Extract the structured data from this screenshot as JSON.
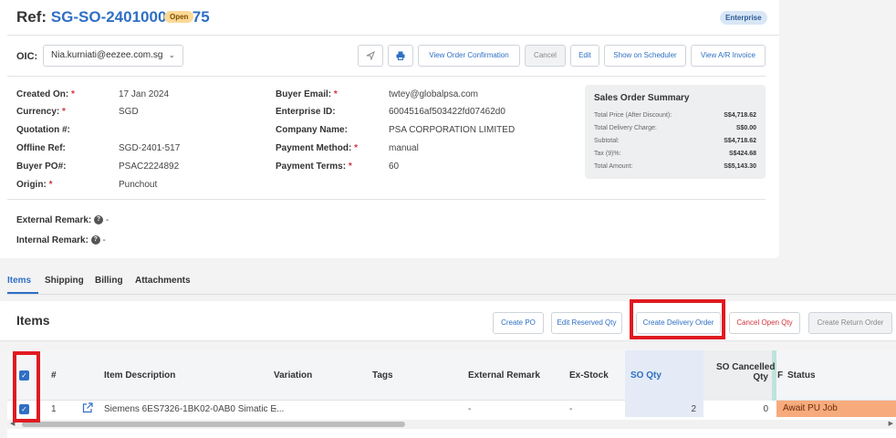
{
  "header": {
    "ref_label": "Ref: ",
    "ref_value": "SG-SO-240100005975",
    "status_badge": "Open",
    "enterprise_badge": "Enterprise"
  },
  "oic": {
    "label": "OIC:",
    "value": "Nia.kurniati@eezee.com.sg"
  },
  "toolbar": {
    "send_icon": "send-icon",
    "print_icon": "print-icon",
    "view_order_confirmation": "View Order Confirmation",
    "cancel": "Cancel",
    "edit": "Edit",
    "show_on_scheduler": "Show on Scheduler",
    "view_ar_invoice": "View A/R Invoice"
  },
  "details_left": [
    {
      "label": "Created On:",
      "required": true,
      "value": "17 Jan 2024"
    },
    {
      "label": "Currency:",
      "required": true,
      "value": "SGD"
    },
    {
      "label": "Quotation #:",
      "required": false,
      "value": ""
    },
    {
      "label": "Offline Ref:",
      "required": false,
      "value": "SGD-2401-517"
    },
    {
      "label": "Buyer PO#:",
      "required": false,
      "value": "PSAC2224892"
    },
    {
      "label": "Origin:",
      "required": true,
      "value": "Punchout"
    }
  ],
  "details_mid": [
    {
      "label": "Buyer Email:",
      "required": true,
      "value": "twtey@globalpsa.com"
    },
    {
      "label": "Enterprise ID:",
      "required": false,
      "value": "6004516af503422fd07462d0"
    },
    {
      "label": "Company Name:",
      "required": false,
      "value": "PSA CORPORATION LIMITED"
    },
    {
      "label": "Payment Method:",
      "required": true,
      "value": "manual"
    },
    {
      "label": "Payment Terms:",
      "required": true,
      "value": "60"
    }
  ],
  "summary": {
    "title": "Sales Order Summary",
    "rows": [
      {
        "label": "Total Price (After Discount):",
        "value": "S$4,718.62"
      },
      {
        "label": "Total Delivery Charge:",
        "value": "S$0.00"
      },
      {
        "label": "Subtotal:",
        "value": "S$4,718.62"
      },
      {
        "label": "Tax (9)%:",
        "value": "S$424.68"
      },
      {
        "label": "Total Amount:",
        "value": "S$5,143.30"
      }
    ]
  },
  "remarks": {
    "external_label": "External Remark:",
    "external_value": "-",
    "internal_label": "Internal Remark:",
    "internal_value": "-",
    "help_glyph": "?"
  },
  "tabs": [
    "Items",
    "Shipping",
    "Billing",
    "Attachments"
  ],
  "items": {
    "title": "Items",
    "actions": {
      "create_po": "Create PO",
      "edit_reserved_qty": "Edit Reserved Qty",
      "create_delivery_order": "Create Delivery Order",
      "cancel_open_qty": "Cancel Open Qty",
      "create_return_order": "Create Return Order"
    },
    "columns": {
      "num": "#",
      "item_description": "Item Description",
      "variation": "Variation",
      "tags": "Tags",
      "external_remark": "External Remark",
      "ex_stock": "Ex-Stock",
      "so_qty": "SO Qty",
      "so_cancelled_qty_1": "SO Cancelled",
      "so_cancelled_qty_2": "Qty",
      "f": "F",
      "status": "Status"
    },
    "rows": [
      {
        "num": "1",
        "item_description": "Siemens 6ES7326-1BK02-0AB0 Simatic E...",
        "variation": "-",
        "tags": "",
        "external_remark": "-",
        "ex_stock": "-",
        "so_qty": "2",
        "so_cancelled_qty": "0",
        "status": "Await PU Job"
      }
    ]
  },
  "colors": {
    "accent": "#2f6fc4",
    "highlight_box": "#e01a21",
    "status_await": "#f7ab7d",
    "open_badge": "#fcd996"
  }
}
